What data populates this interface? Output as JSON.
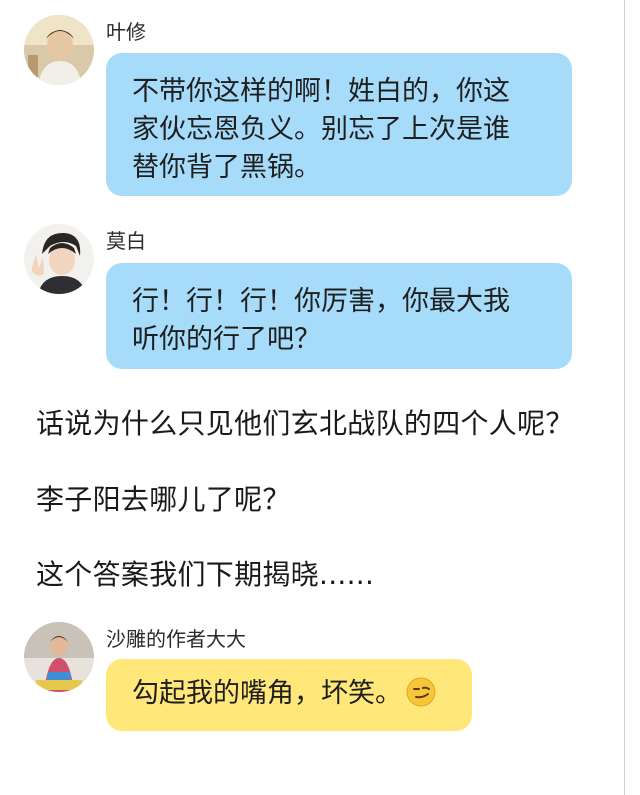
{
  "messages": [
    {
      "sender": "叶修",
      "lines": [
        "不带你这样的啊！姓白的，你这",
        "家伙忘恩负义。别忘了上次是谁",
        "替你背了黑锅。"
      ]
    },
    {
      "sender": "莫白",
      "lines": [
        "行！行！行！你厉害，你最大我",
        "听你的行了吧？"
      ]
    },
    {
      "sender": "沙雕的作者大大",
      "lines": [
        "勾起我的嘴角，坏笑。"
      ],
      "emoji": "smirk-emoji"
    }
  ],
  "narration": [
    "话说为什么只见他们玄北战队的四个人呢？",
    "李子阳去哪儿了呢？",
    "这个答案我们下期揭晓......"
  ],
  "colors": {
    "blue_bubble": "#a6dcfa",
    "yellow_bubble": "#ffe77a",
    "background": "#ffffff"
  }
}
